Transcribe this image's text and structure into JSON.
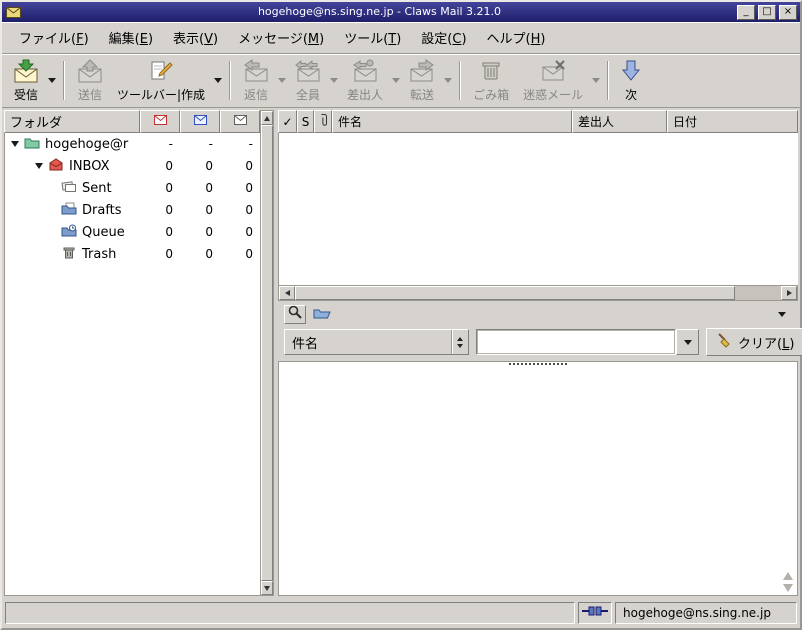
{
  "window": {
    "title": "hogehoge@ns.sing.ne.jp - Claws Mail 3.21.0",
    "buttons": {
      "minimize": "_",
      "maximize": "□",
      "close": "×"
    }
  },
  "colors": {
    "titlebar_top": "#44449c",
    "titlebar_bottom": "#1e1e69",
    "chrome_bg": "#d6d3ce",
    "disabled_text": "#878787",
    "bevel_light": "#ffffff",
    "bevel_dark": "#808080"
  },
  "icons": {
    "dropdown_arrow": "▼",
    "check_column": "✓",
    "expander": "▼"
  },
  "menubar": {
    "items": [
      {
        "pre": "ファイル(",
        "key": "F",
        "post": ")"
      },
      {
        "pre": "編集(",
        "key": "E",
        "post": ")"
      },
      {
        "pre": "表示(",
        "key": "V",
        "post": ")"
      },
      {
        "pre": "メッセージ(",
        "key": "M",
        "post": ")"
      },
      {
        "pre": "ツール(",
        "key": "T",
        "post": ")"
      },
      {
        "pre": "設定(",
        "key": "C",
        "post": ")"
      },
      {
        "pre": "ヘルプ(",
        "key": "H",
        "post": ")"
      }
    ]
  },
  "toolbar": {
    "buttons": [
      {
        "label": "受信",
        "enabled": true,
        "dropdown": true
      },
      {
        "label": "送信",
        "enabled": false,
        "dropdown": false
      },
      {
        "label": "ツールバー|作成",
        "enabled": true,
        "dropdown": true
      },
      {
        "label": "返信",
        "enabled": false,
        "dropdown": true
      },
      {
        "label": "全員",
        "enabled": false,
        "dropdown": true
      },
      {
        "label": "差出人",
        "enabled": false,
        "dropdown": true
      },
      {
        "label": "転送",
        "enabled": false,
        "dropdown": true
      },
      {
        "label": "ごみ箱",
        "enabled": false,
        "dropdown": false
      },
      {
        "label": "迷惑メール",
        "enabled": false,
        "dropdown": true
      },
      {
        "label": "次",
        "enabled": true,
        "dropdown": false
      }
    ]
  },
  "folder_pane": {
    "name_header": "フォルダ",
    "rows": [
      {
        "name": "hogehoge@r",
        "new": "-",
        "unread": "-",
        "total": "-"
      },
      {
        "name": "INBOX",
        "new": "0",
        "unread": "0",
        "total": "0"
      },
      {
        "name": "Sent",
        "new": "0",
        "unread": "0",
        "total": "0"
      },
      {
        "name": "Drafts",
        "new": "0",
        "unread": "0",
        "total": "0"
      },
      {
        "name": "Queue",
        "new": "0",
        "unread": "0",
        "total": "0"
      },
      {
        "name": "Trash",
        "new": "0",
        "unread": "0",
        "total": "0"
      }
    ]
  },
  "message_list": {
    "columns": {
      "mark": "✓",
      "status": "S",
      "subject": "件名",
      "from": "差出人",
      "date": "日付"
    },
    "rows": []
  },
  "quick_search": {
    "type_value": "件名",
    "input_value": "",
    "clear": {
      "pre": "クリア(",
      "key": "L",
      "post": ")"
    }
  },
  "statusbar": {
    "message": "",
    "account": "hogehoge@ns.sing.ne.jp"
  }
}
